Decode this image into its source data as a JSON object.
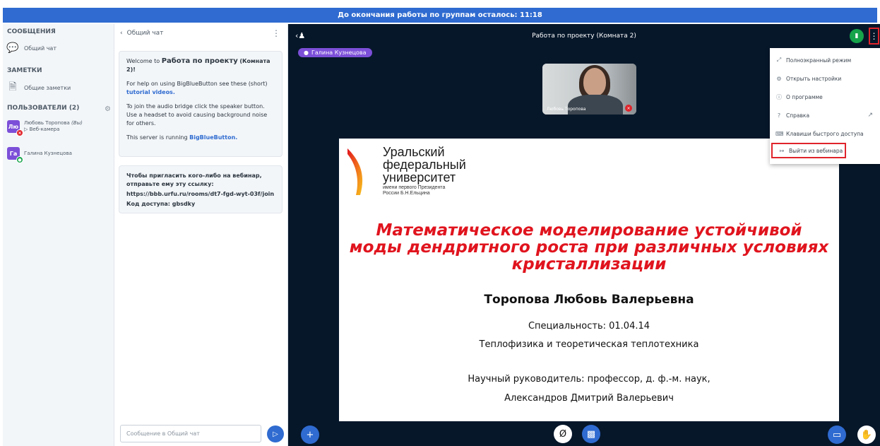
{
  "banner": "До окончания работы по группам осталось: 11:18",
  "sidebar": {
    "messages_title": "СООБЩЕНИЯ",
    "public_chat": "Общий чат",
    "notes_title": "ЗАМЕТКИ",
    "shared_notes": "Общие заметки",
    "users_title": "ПОЛЬЗОВАТЕЛИ (2)",
    "users": [
      {
        "initials": "Лю",
        "name": "Любовь Торопова",
        "you": "(Вы)",
        "status": "Веб-камера",
        "color": "#7c4fd8",
        "dot_color": "#e0242b"
      },
      {
        "initials": "Га",
        "name": "Галина Кузнецова",
        "color": "#7c4fd8",
        "dot_color": "#16a34a"
      }
    ]
  },
  "chat": {
    "header": "Общий чат",
    "welcome_prefix": "Welcome to",
    "welcome_room": "Работа по проекту",
    "welcome_room2": "(Комната 2)!",
    "help_text": "For help on using BigBlueButton see these (short)",
    "tutorial_link": "tutorial videos.",
    "audio_text": "To join the audio bridge click the speaker button. Use a headset to avoid causing background noise for others.",
    "server_text": "This server is running",
    "server_link": "BigBlueButton.",
    "invite_text": "Чтобы пригласить кого-либо на вебинар, отправьте ему эту ссылку:",
    "invite_link": "https://bbb.urfu.ru/rooms/dt7-fgd-wyt-03f/join",
    "access_code": "Код доступа: gbsdky",
    "input_placeholder": "Сообщение в Общий чат"
  },
  "main": {
    "title": "Работа по проекту (Комната 2)",
    "talker": "Галина Кузнецова",
    "webcam_label": "Любовь Торопова"
  },
  "slide": {
    "logo_line1": "Уральский",
    "logo_line2": "федеральный",
    "logo_line3": "университет",
    "logo_sub1": "имени первого Президента",
    "logo_sub2": "России Б.Н.Ельцина",
    "title_line1": "Математическое моделирование устойчивой",
    "title_line2": "моды дендритного роста при различных условиях",
    "title_line3": "кристаллизации",
    "author": "Торопова Любовь Валерьевна",
    "specialty": "Специальность: 01.04.14",
    "field": "Теплофизика и теоретическая теплотехника",
    "advisor": "Научный руководитель: профессор, д. ф.-м. наук,",
    "advisor_name": "Александров Дмитрий Валерьевич"
  },
  "menu": {
    "items": [
      "Полноэкранный режим",
      "Открыть настройки",
      "О программе",
      "Справка",
      "Клавиши быстрого доступа",
      "Выйти из вебинара"
    ]
  }
}
